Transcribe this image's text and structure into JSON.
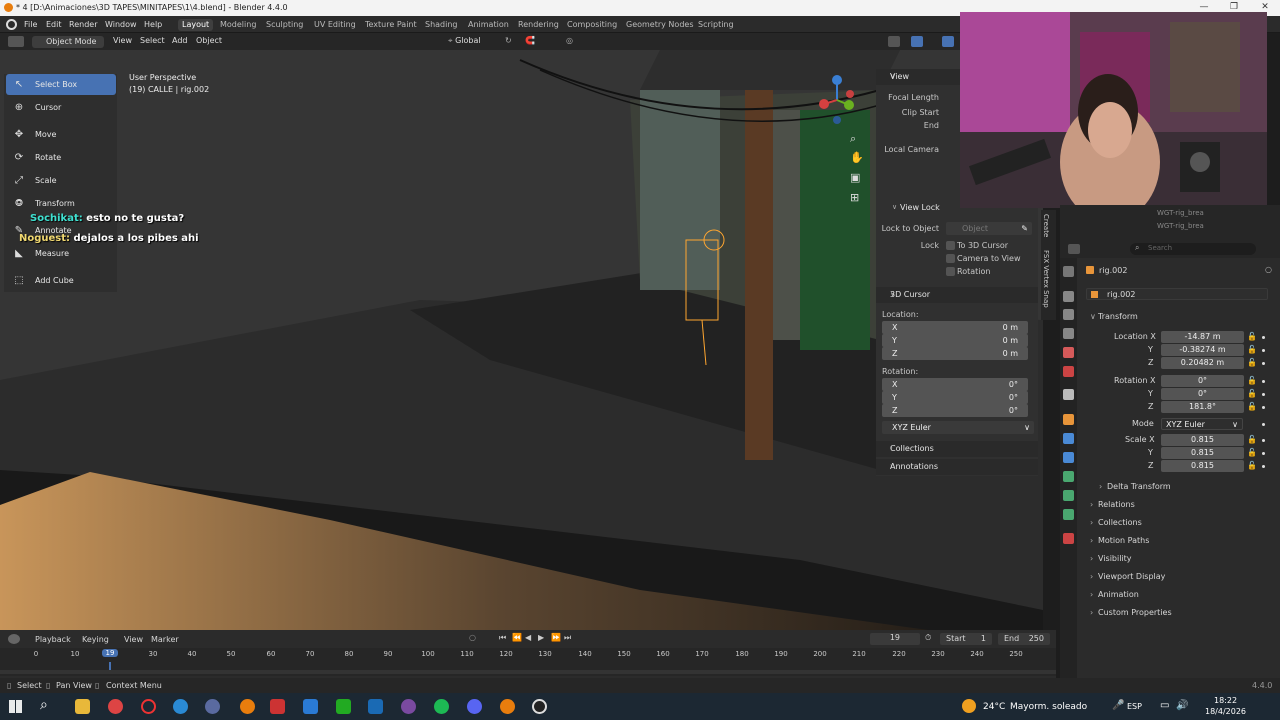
{
  "window": {
    "title": "* 4 [D:\\Animaciones\\3D TAPES\\MINITAPES\\1\\4.blend] - Blender 4.4.0",
    "controls": [
      "—",
      "❐",
      "✕"
    ]
  },
  "menu": {
    "items": [
      "File",
      "Edit",
      "Render",
      "Window",
      "Help"
    ],
    "workspaces": [
      "Layout",
      "Modeling",
      "Sculpting",
      "UV Editing",
      "Texture Paint",
      "Shading",
      "Animation",
      "Rendering",
      "Compositing",
      "Geometry Nodes",
      "Scripting"
    ],
    "active_workspace": "Layout"
  },
  "viewport_header": {
    "mode": "Object Mode",
    "menus": [
      "View",
      "Select",
      "Add",
      "Object"
    ],
    "orientation": "Global"
  },
  "viewport": {
    "perspective": "User Perspective",
    "collection": "(19) CALLE | rig.002"
  },
  "toolbar": {
    "tools": [
      {
        "label": "Select Box",
        "icon": "select-box-icon",
        "active": true
      },
      {
        "label": "Cursor",
        "icon": "cursor-icon"
      },
      {
        "label": "Move",
        "icon": "move-icon"
      },
      {
        "label": "Rotate",
        "icon": "rotate-icon"
      },
      {
        "label": "Scale",
        "icon": "scale-icon"
      },
      {
        "label": "Transform",
        "icon": "transform-icon"
      },
      {
        "label": "Annotate",
        "icon": "annotate-icon"
      },
      {
        "label": "Measure",
        "icon": "measure-icon"
      },
      {
        "label": "Add Cube",
        "icon": "add-cube-icon"
      }
    ]
  },
  "chat": [
    {
      "user": "Sochikat:",
      "message": "esto no te gusta?",
      "user_color": "#3fe0d0"
    },
    {
      "user": "Noguest:",
      "message": "dejalos a los pibes ahi",
      "user_color": "#f0d870"
    }
  ],
  "npanel": {
    "view": {
      "title": "View",
      "focal_length": "Focal Length",
      "clip_start": "Clip Start",
      "end": "End",
      "local_camera": "Local Camera"
    },
    "view_lock": {
      "title": "View Lock",
      "lock_to_object": "Lock to Object",
      "object_placeholder": "Object",
      "lock": "Lock",
      "to_3d_cursor": "To 3D Cursor",
      "camera_to_view": "Camera to View",
      "rotation": "Rotation"
    },
    "cursor": {
      "title": "3D Cursor",
      "location": "Location:",
      "loc": [
        {
          "axis": "X",
          "value": "0 m"
        },
        {
          "axis": "Y",
          "value": "0 m"
        },
        {
          "axis": "Z",
          "value": "0 m"
        }
      ],
      "rotation": "Rotation:",
      "rot": [
        {
          "axis": "X",
          "value": "0°"
        },
        {
          "axis": "Y",
          "value": "0°"
        },
        {
          "axis": "Z",
          "value": "0°"
        }
      ],
      "mode": "XYZ Euler"
    },
    "collections": "Collections",
    "annotations": "Annotations",
    "tabs": [
      "Create",
      "FSX Vertex Snap"
    ]
  },
  "outliner": {
    "rows": [
      "WGT-rig_brea",
      "WGT-rig_brea"
    ]
  },
  "properties": {
    "search_placeholder": "Search",
    "object_name": "rig.002",
    "object_field": "rig.002",
    "transform": "Transform",
    "location_label": "Location X",
    "location": [
      "-14.87 m",
      "-0.38274 m",
      "0.20482 m"
    ],
    "rotation_label": "Rotation X",
    "rotation": [
      "0°",
      "0°",
      "181.8°"
    ],
    "mode_label": "Mode",
    "mode": "XYZ Euler",
    "scale_label": "Scale X",
    "scale": [
      "0.815",
      "0.815",
      "0.815"
    ],
    "axis_y": "Y",
    "axis_z": "Z",
    "sections": [
      "Delta Transform",
      "Relations",
      "Collections",
      "Motion Paths",
      "Visibility",
      "Viewport Display",
      "Animation",
      "Custom Properties"
    ]
  },
  "timeline": {
    "menus": [
      "Playback",
      "Keying",
      "View",
      "Marker"
    ],
    "current_frame": "19",
    "start_label": "Start",
    "start": "1",
    "end_label": "End",
    "end": "250",
    "ticks": [
      "0",
      "10",
      "19",
      "30",
      "40",
      "50",
      "60",
      "70",
      "80",
      "90",
      "100",
      "110",
      "120",
      "130",
      "140",
      "150",
      "160",
      "170",
      "180",
      "190",
      "200",
      "210",
      "220",
      "230",
      "240",
      "250"
    ]
  },
  "statusbar": {
    "hints": [
      "Select",
      "Pan View",
      "Context Menu"
    ],
    "version": "4.4.0"
  },
  "taskbar": {
    "weather_temp": "24°C",
    "weather_text": "Mayorm. soleado",
    "language": "ESP",
    "time": "18:22",
    "date": "18/4/2026"
  },
  "colors": {
    "accent": "#4772b3",
    "header": "#2b2b2b",
    "panel": "#303030"
  }
}
